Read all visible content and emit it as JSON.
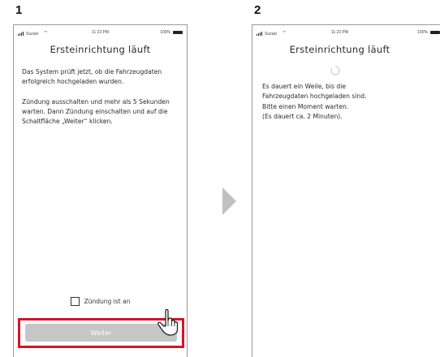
{
  "steps": {
    "one": {
      "number": "1",
      "status_bar": {
        "carrier": "Suzuki",
        "time": "11:23 PM",
        "battery": "100%"
      },
      "title": "Ersteinrichtung läuft",
      "paragraphs": [
        "Das System prüft jetzt, ob die Fahrzeugdaten erfolgreich hochgeladen wurden.",
        "Zündung ausschalten und mehr als 5 Sekunden warten. Dann Zündung einschalten und auf die Schaltfläche „Weiter“ klicken."
      ],
      "checkbox_label": "Zündung ist an",
      "button_label": "Weiter"
    },
    "two": {
      "number": "2",
      "status_bar": {
        "carrier": "Suzuki",
        "time": "11:23 PM",
        "battery": "100%"
      },
      "title": "Ersteinrichtung läuft",
      "message_lines": [
        "Es dauert ein Weile, bis die",
        "Fahrzeugdaten hochgeladen sind.",
        "Bitte einen Moment warten.",
        "(Es dauert ca. 2 Minuten)."
      ]
    }
  },
  "icons": [
    "signal-icon",
    "wifi-icon",
    "battery-icon",
    "loading-spinner-icon",
    "hand-pointer-icon",
    "arrow-right-icon"
  ],
  "colors": {
    "highlight": "#d9122a",
    "button_disabled": "#c6c6c6",
    "arrow": "#c0c0c0"
  }
}
